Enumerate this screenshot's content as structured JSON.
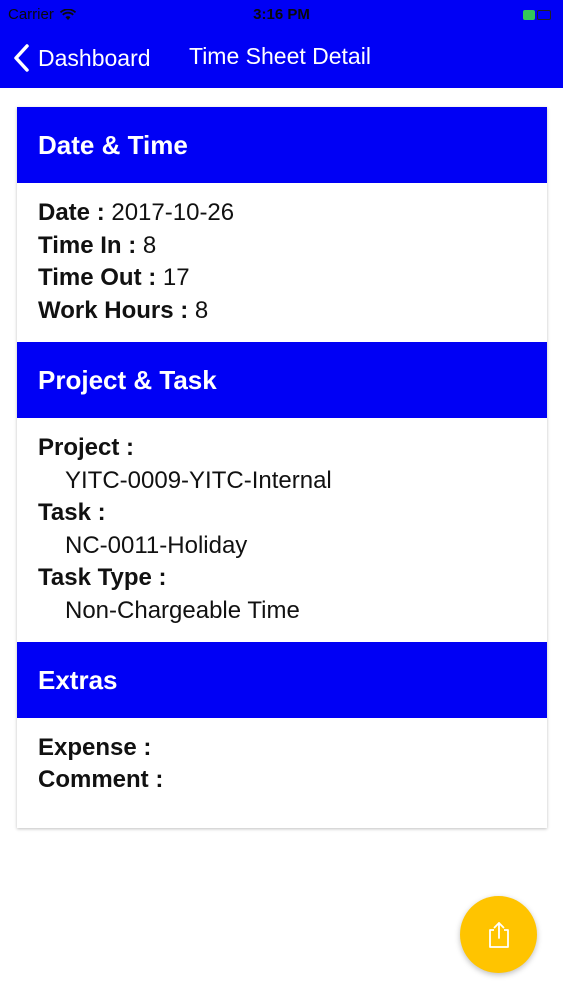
{
  "status_bar": {
    "carrier": "Carrier",
    "time": "3:16 PM"
  },
  "nav": {
    "back_label": "Dashboard",
    "title": "Time Sheet Detail"
  },
  "sections": {
    "date_time": {
      "header": "Date & Time",
      "date_key": "Date : ",
      "date_value": "2017-10-26",
      "time_in_key": "Time In : ",
      "time_in_value": "8",
      "time_out_key": "Time Out : ",
      "time_out_value": "17",
      "work_hours_key": "Work Hours : ",
      "work_hours_value": "8"
    },
    "project_task": {
      "header": "Project & Task",
      "project_key": "Project :",
      "project_value": "YITC-0009-YITC-Internal",
      "task_key": "Task :",
      "task_value": "NC-0011-Holiday",
      "task_type_key": "Task Type :",
      "task_type_value": "Non-Chargeable Time"
    },
    "extras": {
      "header": "Extras",
      "expense_key": "Expense :",
      "comment_key": "Comment :"
    }
  },
  "fab": {
    "icon": "share-icon"
  },
  "colors": {
    "primary": "#0000f5",
    "fab": "#ffc400"
  }
}
